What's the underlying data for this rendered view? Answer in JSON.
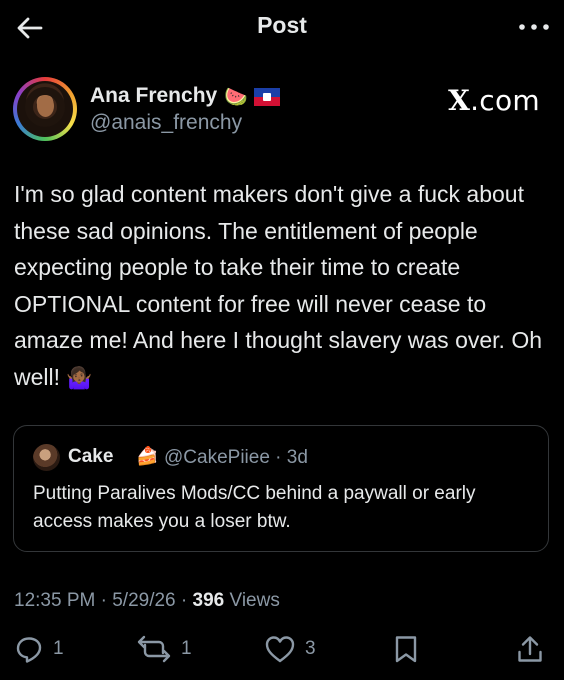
{
  "header": {
    "title": "Post"
  },
  "author": {
    "name": "Ana Frenchy",
    "name_emoji": "🍉",
    "handle": "@anais_frenchy"
  },
  "watermark": {
    "x": "X",
    "suffix": ".com"
  },
  "post": {
    "text": "I'm so glad content makers don't give a fuck about these sad opinions. The entitlement of people expecting people to take their time to create OPTIONAL content for free will never cease to amaze me! And here I thought slavery was over. Oh well!",
    "trailing_emoji": "🤷🏾‍♀️"
  },
  "quote": {
    "name": "Cake",
    "name_emoji": "🍰",
    "handle": "@CakePiiee",
    "time": "3d",
    "text": "Putting Paralives Mods/CC behind a paywall or early access makes you a loser btw."
  },
  "meta": {
    "time": "12:35 PM",
    "date": "5/29/26",
    "views_count": "396",
    "views_label": "Views"
  },
  "actions": {
    "replies": "1",
    "reposts": "1",
    "likes": "3"
  },
  "colors": {
    "background": "#000000",
    "text": "#e7e9ea",
    "muted": "#8b98a5",
    "border": "#333639"
  },
  "icons": [
    "back-arrow-icon",
    "more-icon",
    "reply-icon",
    "repost-icon",
    "like-icon",
    "bookmark-icon",
    "share-icon"
  ]
}
